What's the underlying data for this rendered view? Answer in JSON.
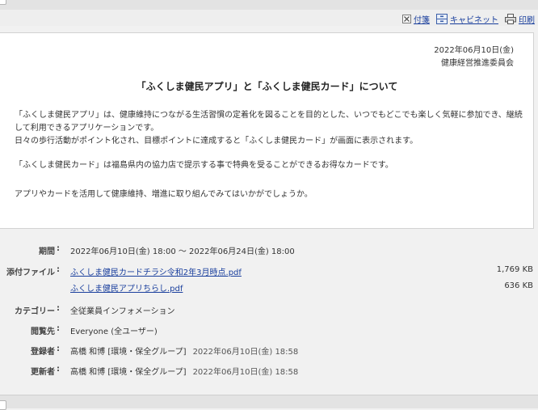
{
  "toolbar": {
    "tag_label": "付箋",
    "cabinet_label": "キャビネット",
    "print_label": "印刷"
  },
  "notice": {
    "date": "2022年06月10日(金)",
    "committee": "健康経営推進委員会",
    "title": "「ふくしま健民アプリ」と「ふくしま健民カード」について",
    "paragraphs": [
      "「ふくしま健民アプリ」は、健康維持につながる生活習慣の定着化を図ることを目的とした、いつでもどこでも楽しく気軽に参加でき、継続して利用できるアプリケーションです。",
      "日々の歩行活動がポイント化され、目標ポイントに達成すると「ふくしま健民カード」が画面に表示されます。",
      "「ふくしま健民カード」は福島県内の協力店で提示する事で特典を受ることができるお得なカードです。",
      "アプリやカードを活用して健康維持、増進に取り組んでみてはいかがでしょうか。"
    ]
  },
  "details": {
    "period": {
      "label": "期間",
      "value": "2022年06月10日(金) 18:00 〜 2022年06月24日(金) 18:00"
    },
    "attachments": {
      "label": "添付ファイル",
      "files": [
        {
          "name": "ふくしま健民カードチラシ令和2年3月時点.pdf",
          "size": "1,769 KB"
        },
        {
          "name": "ふくしま健民アプリちらし.pdf",
          "size": "636 KB"
        }
      ]
    },
    "category": {
      "label": "カテゴリー",
      "value": "全従業員インフォメーション"
    },
    "viewers": {
      "label": "閲覧先",
      "value": "Everyone (全ユーザー)"
    },
    "registrant": {
      "label": "登録者",
      "name": "高橋 和博 [環境・保全グループ]",
      "time": "2022年06月10日(金) 18:58"
    },
    "updater": {
      "label": "更新者",
      "name": "高橋 和博 [環境・保全グループ]",
      "time": "2022年06月10日(金) 18:58"
    }
  },
  "colors": {
    "link": "#1a3f9d",
    "background": "#f1f1f1",
    "panel": "#ffffff"
  },
  "icons": [
    "tag-icon",
    "cabinet-icon",
    "print-icon"
  ]
}
